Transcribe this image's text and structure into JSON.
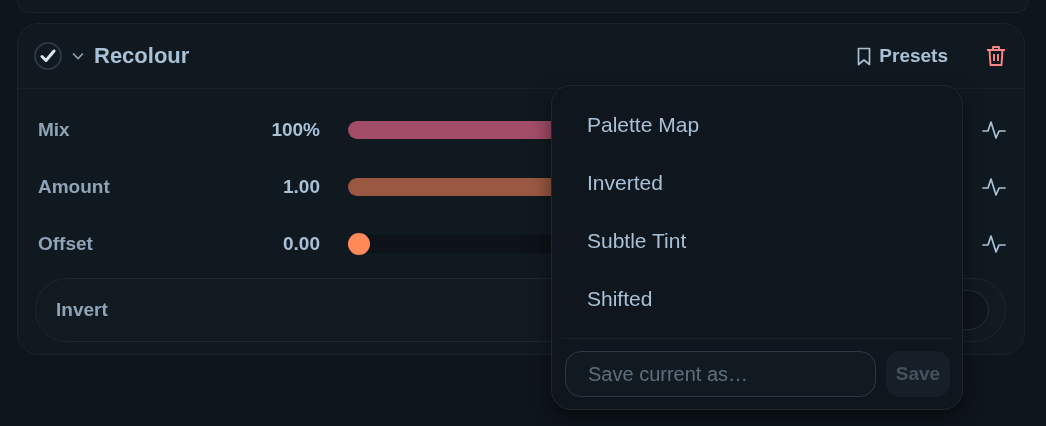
{
  "effect": {
    "title": "Recolour",
    "enabled": true,
    "expanded": true,
    "presets_label": "Presets",
    "params": [
      {
        "label": "Mix",
        "value": "100%",
        "level": 1,
        "color": "#a24d68"
      },
      {
        "label": "Amount",
        "value": "1.00",
        "level": 1,
        "color": "#9a5842"
      },
      {
        "label": "Offset",
        "value": "0.00",
        "level": 0,
        "color": "#ff8a57"
      }
    ],
    "toggle": {
      "label": "Invert",
      "on": false
    }
  },
  "presets_menu": {
    "items": [
      "Palette Map",
      "Inverted",
      "Subtle Tint",
      "Shifted"
    ],
    "name_field": {
      "placeholder": "Save current as…"
    },
    "save_button": {
      "label": "Save",
      "disabled": true
    }
  }
}
